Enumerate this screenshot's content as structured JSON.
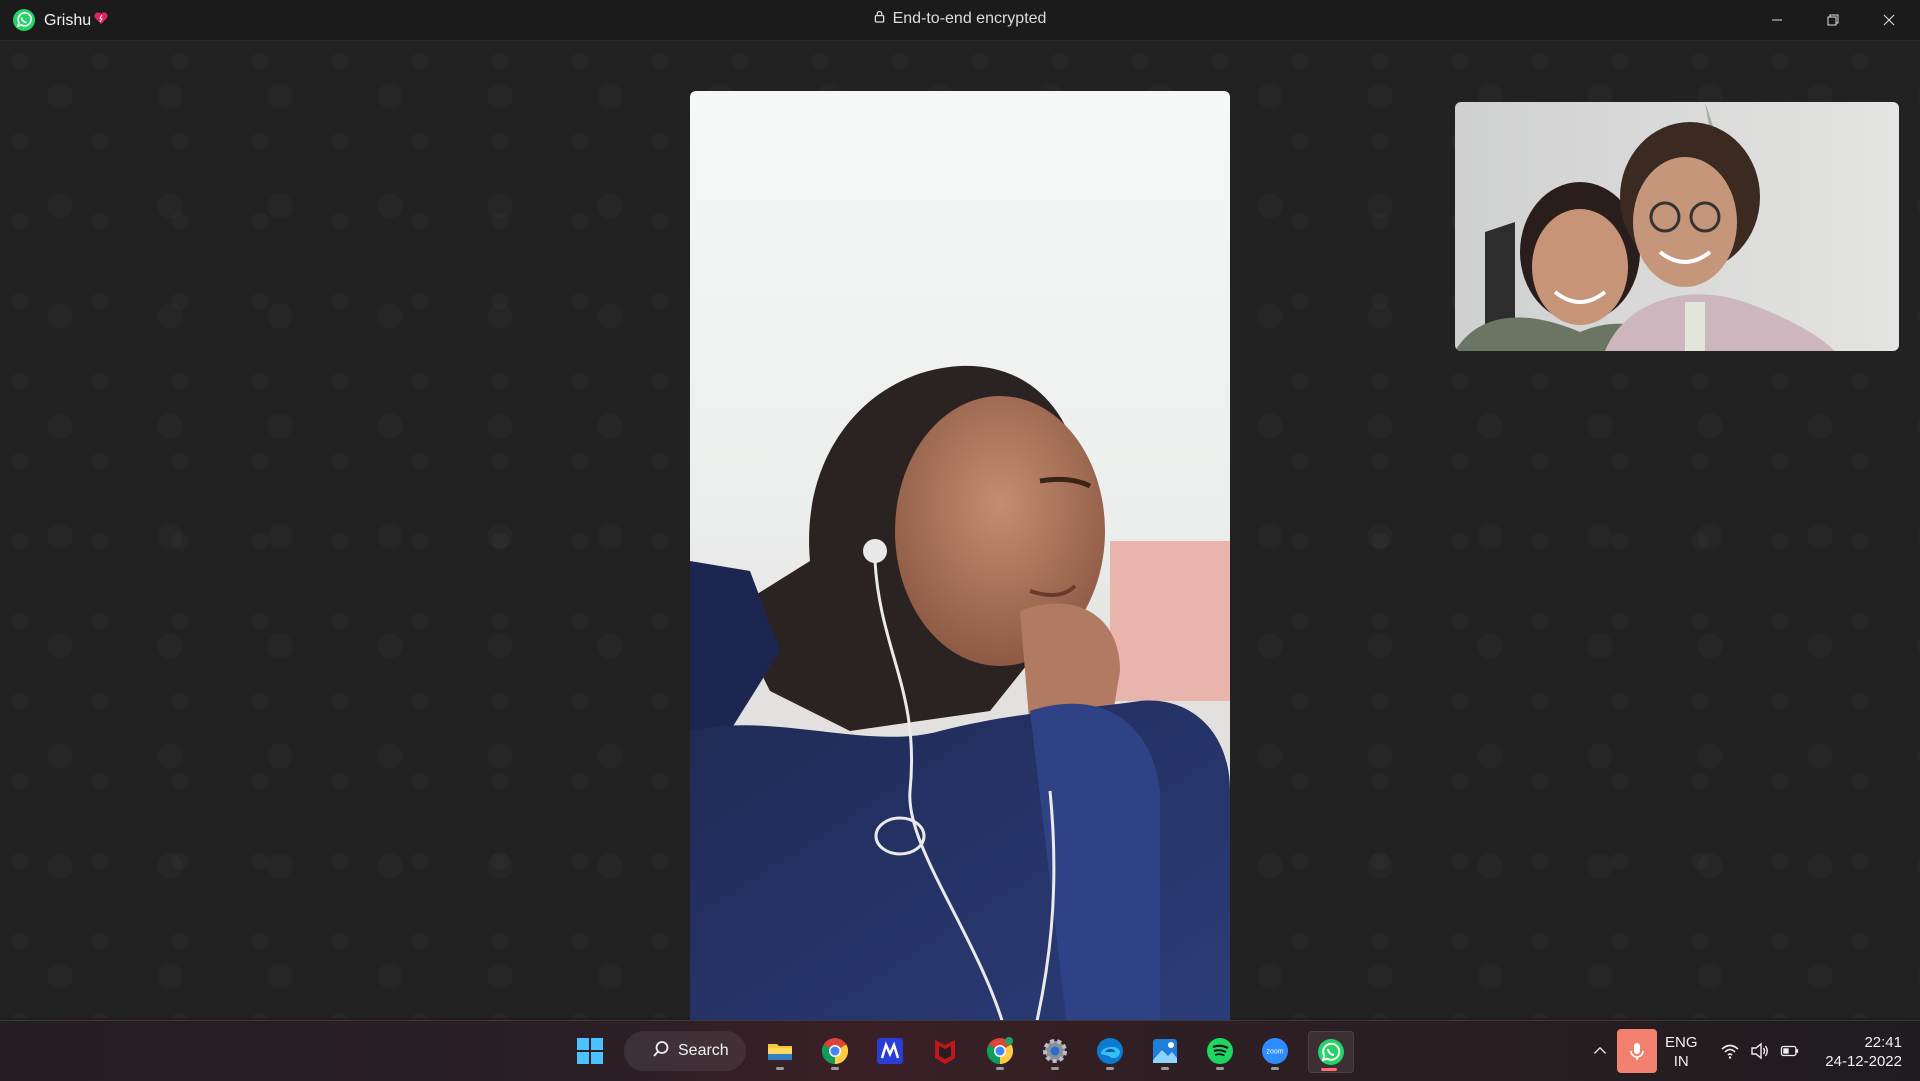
{
  "window": {
    "contact_name": "Grishu",
    "status_text": "End-to-end encrypted",
    "controls": [
      "minimize-icon",
      "restore-icon",
      "close-icon"
    ]
  },
  "call": {
    "main_video": "remote participant video feed",
    "self_view": "local camera preview"
  },
  "taskbar": {
    "search_label": "Search",
    "apps": [
      {
        "name": "start",
        "icon": "windows-start-icon"
      },
      {
        "name": "search",
        "icon": "search-icon"
      },
      {
        "name": "file-explorer",
        "icon": "folder-icon"
      },
      {
        "name": "chrome",
        "icon": "chrome-icon"
      },
      {
        "name": "app-m",
        "icon": "m-app-icon"
      },
      {
        "name": "mcafee",
        "icon": "mcafee-icon"
      },
      {
        "name": "chrome-profile",
        "icon": "chrome-icon"
      },
      {
        "name": "settings",
        "icon": "gear-icon"
      },
      {
        "name": "edge",
        "icon": "edge-icon"
      },
      {
        "name": "photos",
        "icon": "photos-icon"
      },
      {
        "name": "spotify",
        "icon": "spotify-icon"
      },
      {
        "name": "zoom",
        "icon": "zoom-icon"
      },
      {
        "name": "whatsapp",
        "icon": "whatsapp-icon"
      }
    ],
    "zoom_label": "zoom",
    "tray": {
      "lang_line1": "ENG",
      "lang_line2": "IN",
      "time": "22:41",
      "date": "24-12-2022"
    }
  },
  "colors": {
    "whatsapp_green": "#25D366",
    "mic_accent": "#f1806e",
    "background": "#222222"
  }
}
